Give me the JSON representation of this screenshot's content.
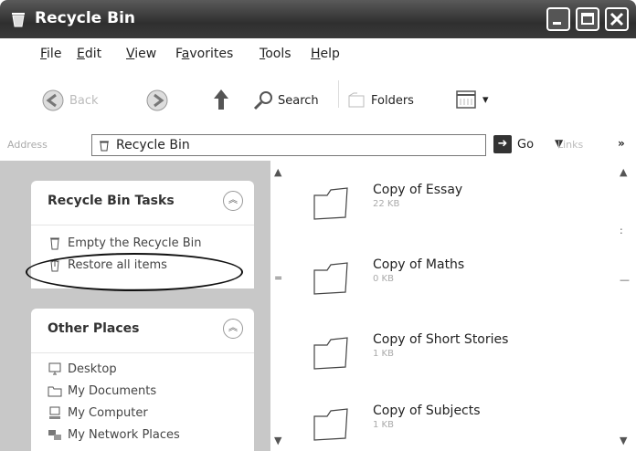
{
  "window": {
    "title": "Recycle Bin",
    "buttons": [
      "minimize",
      "maximize",
      "close"
    ]
  },
  "menu": {
    "items": [
      "File",
      "Edit",
      "View",
      "Favorites",
      "Tools",
      "Help"
    ],
    "mnemonics": [
      "F",
      "E",
      "V",
      "a",
      "T",
      "H"
    ]
  },
  "toolbar": {
    "back_label": "Back",
    "search_label": "Search",
    "folders_label": "Folders"
  },
  "address": {
    "label": "Address",
    "value": "Recycle Bin",
    "go_label": "Go",
    "links_label": "Links",
    "more": "»"
  },
  "tasks": {
    "title": "Recycle Bin Tasks",
    "items": [
      {
        "label": "Empty the Recycle Bin",
        "icon": "recycle-bin-icon"
      },
      {
        "label": "Restore all items",
        "icon": "restore-icon"
      }
    ]
  },
  "places": {
    "title": "Other Places",
    "items": [
      {
        "label": "Desktop",
        "icon": "desktop-icon"
      },
      {
        "label": "My Documents",
        "icon": "folder-icon"
      },
      {
        "label": "My Computer",
        "icon": "computer-icon"
      },
      {
        "label": "My Network Places",
        "icon": "network-icon"
      }
    ]
  },
  "files": [
    {
      "name": "Copy of Essay",
      "size": "22 KB"
    },
    {
      "name": "Copy of Maths",
      "size": "0 KB"
    },
    {
      "name": "Copy of Short Stories",
      "size": "1 KB"
    },
    {
      "name": "Copy of Subjects",
      "size": "1 KB"
    }
  ]
}
